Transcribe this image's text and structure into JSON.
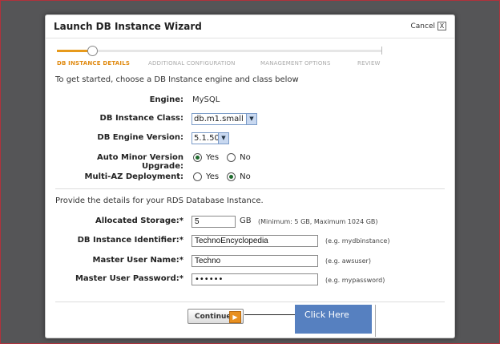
{
  "dialog": {
    "title": "Launch DB Instance Wizard",
    "cancel_label": "Cancel",
    "close_glyph": "X"
  },
  "steps": [
    {
      "label": "DB INSTANCE DETAILS",
      "active": true
    },
    {
      "label": "ADDITIONAL CONFIGURATION",
      "active": false
    },
    {
      "label": "MANAGEMENT OPTIONS",
      "active": false
    },
    {
      "label": "REVIEW",
      "active": false
    }
  ],
  "engine_section": {
    "intro": "To get started, choose a DB Instance engine and class below",
    "engine_label": "Engine:",
    "engine_value": "MySQL",
    "class_label": "DB Instance Class:",
    "class_value": "db.m1.small",
    "version_label": "DB Engine Version:",
    "version_value": "5.1.50",
    "auto_minor_label": "Auto Minor Version Upgrade:",
    "auto_minor_yes": "Yes",
    "auto_minor_no": "No",
    "auto_minor_selected": "Yes",
    "multi_az_label": "Multi-AZ Deployment:",
    "multi_az_yes": "Yes",
    "multi_az_no": "No",
    "multi_az_selected": "No"
  },
  "details_section": {
    "intro": "Provide the details for your RDS Database Instance.",
    "storage_label": "Allocated Storage:*",
    "storage_value": "5",
    "storage_unit": "GB",
    "storage_hint": "(Minimum: 5 GB, Maximum 1024 GB)",
    "identifier_label": "DB Instance Identifier:*",
    "identifier_value": "TechnoEncyclopedia",
    "identifier_hint": "(e.g. mydbinstance)",
    "username_label": "Master User Name:*",
    "username_value": "Techno",
    "username_hint": "(e.g. awsuser)",
    "password_label": "Master User Password:*",
    "password_value": "••••••",
    "password_hint": "(e.g. mypassword)"
  },
  "footer": {
    "continue_label": "Continue",
    "continue_arrow": "▶"
  },
  "annotation": {
    "callout_text": "Click Here"
  },
  "icons": {
    "close": "close-icon",
    "dropdown": "chevron-down-icon",
    "continue_arrow": "arrow-right-icon"
  },
  "colors": {
    "active_step": "#e08a10",
    "progress_fill": "#e79a1c",
    "callout_bg": "#5680c0",
    "radio_dot": "#1e6a2c"
  }
}
